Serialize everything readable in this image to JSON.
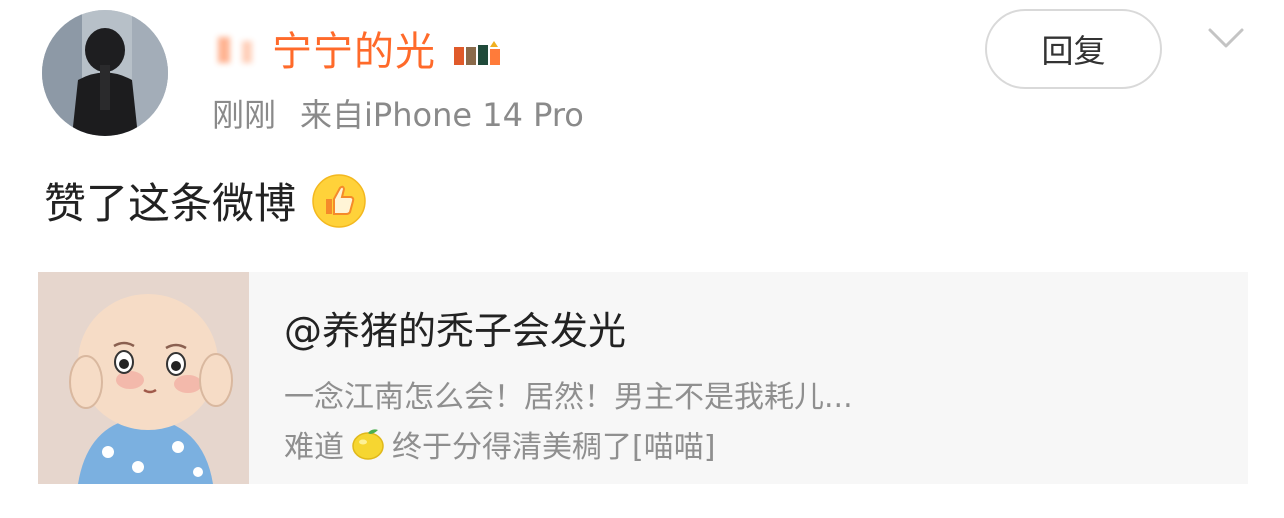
{
  "post": {
    "username": "宁宁的光",
    "time": "刚刚",
    "source": "来自iPhone 14 Pro",
    "reply_label": "回复",
    "action_text": "赞了这条微博",
    "thumbs_icon": "thumbs-up-icon",
    "colors": {
      "username": "#ff6a2a",
      "meta": "#8a8a8a",
      "card_bg": "#f7f7f7"
    }
  },
  "quoted": {
    "author": "@养猪的秃子会发光",
    "line1": "一念江南怎么会！居然！男主不是我耗儿...",
    "line2_before": "难道",
    "line2_after": "终于分得清美稠了[喵喵]",
    "lemon_icon": "lemon-icon"
  }
}
